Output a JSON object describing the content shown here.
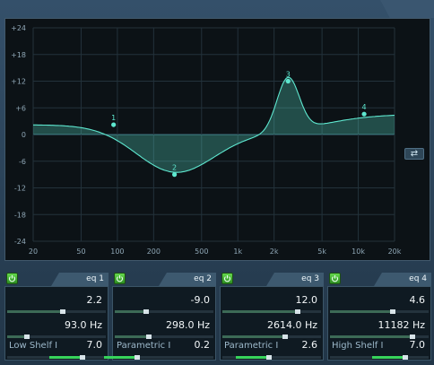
{
  "graph": {
    "db_ticks": [
      "+24",
      "+18",
      "+12",
      "+6",
      "0",
      "-6",
      "-12",
      "-18",
      "-24"
    ],
    "freq_ticks": [
      "20",
      "50",
      "100",
      "200",
      "500",
      "1k",
      "2k",
      "5k",
      "10k",
      "20k"
    ],
    "markers": [
      {
        "label": "1",
        "freq_hz": 93,
        "gain_db": 2.2
      },
      {
        "label": "2",
        "freq_hz": 298,
        "gain_db": -9.0
      },
      {
        "label": "3",
        "freq_hz": 2614,
        "gain_db": 12.0
      },
      {
        "label": "4",
        "freq_hz": 11182,
        "gain_db": 4.6
      }
    ],
    "link_icon": "link-icon"
  },
  "bands": [
    {
      "title": "eq 1",
      "gain": "2.2",
      "freq": "93.0 Hz",
      "type": "Low Shelf I",
      "q": "7.0",
      "gain_pct": 0.55,
      "freq_pct": 0.18,
      "q_pct": 0.75
    },
    {
      "title": "eq 2",
      "gain": "-9.0",
      "freq": "298.0 Hz",
      "type": "Parametric I",
      "q": "0.2",
      "gain_pct": 0.3,
      "freq_pct": 0.32,
      "q_pct": 0.2
    },
    {
      "title": "eq 3",
      "gain": "12.0",
      "freq": "2614.0 Hz",
      "type": "Parametric I",
      "q": "2.6",
      "gain_pct": 0.75,
      "freq_pct": 0.62,
      "q_pct": 0.45
    },
    {
      "title": "eq 4",
      "gain": "4.6",
      "freq": "11182 Hz",
      "type": "High Shelf I",
      "q": "7.0",
      "gain_pct": 0.62,
      "freq_pct": 0.82,
      "q_pct": 0.75
    }
  ],
  "colors": {
    "curve": "#5ee7cf",
    "power": "#3fb52c"
  }
}
